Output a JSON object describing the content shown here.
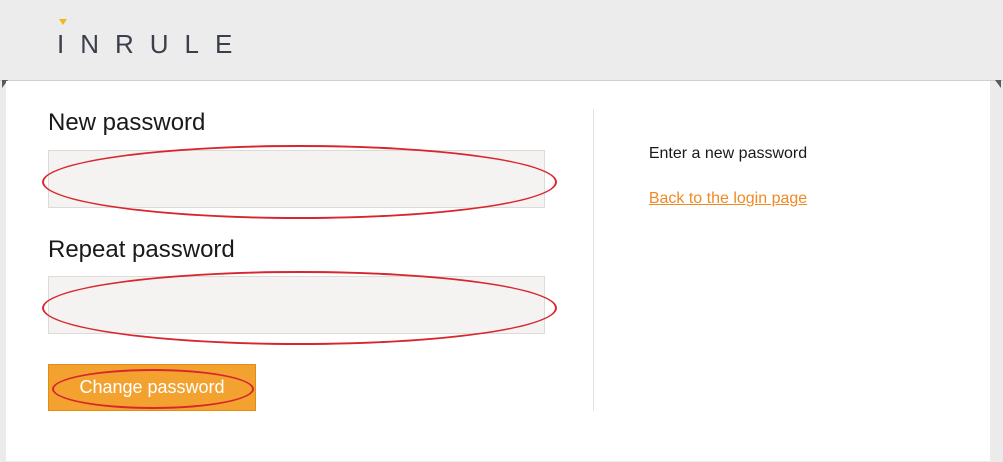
{
  "header": {
    "logo_text": "INRULE",
    "logo_accent_color": "#f2b81a"
  },
  "form": {
    "new_password_label": "New password",
    "new_password_value": "",
    "repeat_password_label": "Repeat password",
    "repeat_password_value": "",
    "submit_label": "Change password",
    "button_color": "#f3a12f",
    "highlight_color": "#d8262e"
  },
  "side": {
    "hint": "Enter a new password",
    "back_link": "Back to the login page",
    "link_color": "#ef8a25"
  }
}
